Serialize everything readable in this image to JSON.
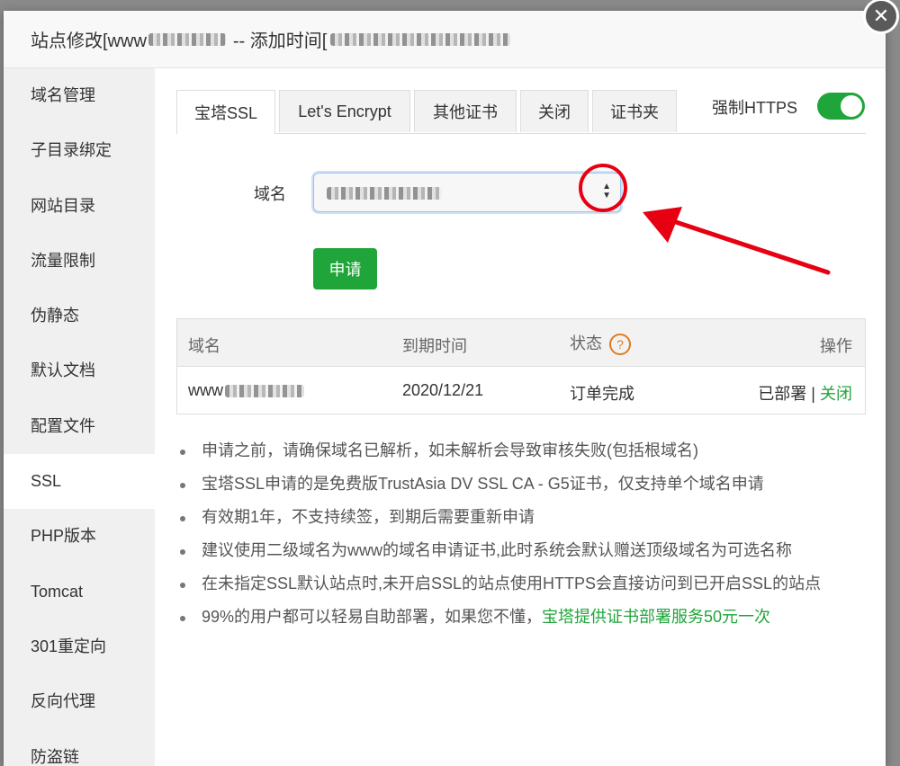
{
  "dialog": {
    "title_prefix": "站点修改[www",
    "title_middle": "-- 添加时间[",
    "close_icon": "close-icon"
  },
  "sidebar": {
    "items": [
      {
        "label": "域名管理"
      },
      {
        "label": "子目录绑定"
      },
      {
        "label": "网站目录"
      },
      {
        "label": "流量限制"
      },
      {
        "label": "伪静态"
      },
      {
        "label": "默认文档"
      },
      {
        "label": "配置文件"
      },
      {
        "label": "SSL"
      },
      {
        "label": "PHP版本"
      },
      {
        "label": "Tomcat"
      },
      {
        "label": "301重定向"
      },
      {
        "label": "反向代理"
      },
      {
        "label": "防盗链"
      }
    ],
    "active_index": 7
  },
  "tabs": [
    {
      "label": "宝塔SSL"
    },
    {
      "label": "Let's Encrypt"
    },
    {
      "label": "其他证书"
    },
    {
      "label": "关闭"
    },
    {
      "label": "证书夹"
    }
  ],
  "force_https": {
    "label": "强制HTTPS",
    "enabled": true
  },
  "domain_field": {
    "label": "域名"
  },
  "apply_button": {
    "label": "申请"
  },
  "table": {
    "headers": {
      "domain": "域名",
      "expire": "到期时间",
      "status": "状态",
      "action": "操作"
    },
    "help_icon_text": "?",
    "rows": [
      {
        "domain_prefix": "www",
        "expire": "2020/12/21",
        "status": "订单完成",
        "deployed": "已部署",
        "separator": "|",
        "close": "关闭"
      }
    ]
  },
  "notes": [
    {
      "text": "申请之前，请确保域名已解析，如未解析会导致审核失败(包括根域名)"
    },
    {
      "text": "宝塔SSL申请的是免费版TrustAsia DV SSL CA - G5证书，仅支持单个域名申请"
    },
    {
      "text": "有效期1年，不支持续签，到期后需要重新申请"
    },
    {
      "text": "建议使用二级域名为www的域名申请证书,此时系统会默认赠送顶级域名为可选名称"
    },
    {
      "text": "在未指定SSL默认站点时,未开启SSL的站点使用HTTPS会直接访问到已开启SSL的站点"
    },
    {
      "text": "99%的用户都可以轻易自助部署，如果您不懂，",
      "link": "宝塔提供证书部署服务50元一次"
    }
  ],
  "colors": {
    "accent": "#20a53a",
    "annotation": "#e60012",
    "help": "#e07b1f"
  }
}
